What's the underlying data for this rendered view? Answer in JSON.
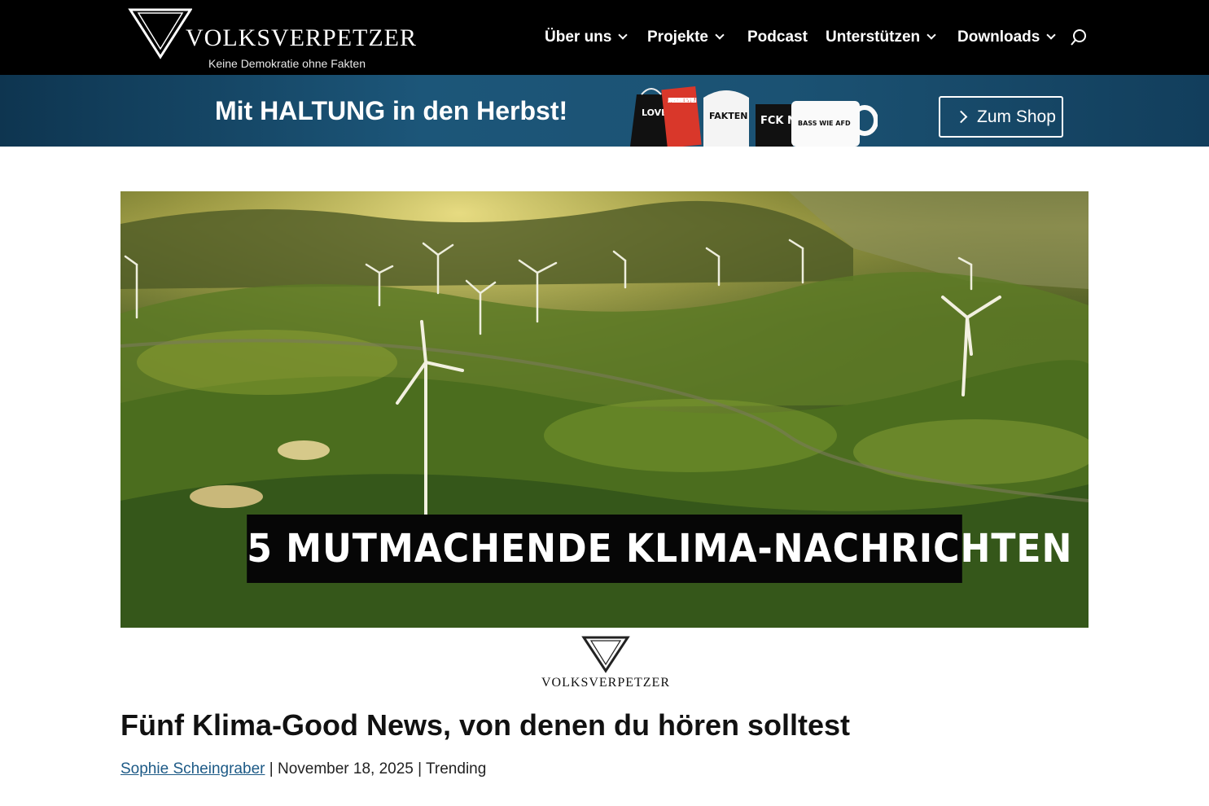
{
  "header": {
    "logo": {
      "wordmark": "VOLKSVERPETZER",
      "tagline": "Keine Demokratie ohne Fakten"
    },
    "nav": [
      {
        "label": "Über uns",
        "has_dropdown": true
      },
      {
        "label": "Projekte",
        "has_dropdown": true
      },
      {
        "label": "Podcast",
        "has_dropdown": false
      },
      {
        "label": "Unterstützen",
        "has_dropdown": true
      },
      {
        "label": "Downloads",
        "has_dropdown": true
      }
    ],
    "search_icon": "search-icon"
  },
  "promo": {
    "title": "Mit HALTUNG in den Herbst!",
    "button_label": "Zum Shop",
    "merch_texts": [
      "LOVE WINS",
      "FAKTEN GEGEN RECHTE MYTHEN",
      "FAKTEN",
      "FCK NZS",
      "BASS WIE AFD"
    ]
  },
  "hero": {
    "caption": "5 MUTMACHENDE KLIMA-NACHRICHTEN",
    "logo_word": "VOLKSVERPETZER"
  },
  "article": {
    "title": "Fünf Klima-Good News, von denen du hören solltest",
    "author": "Sophie Scheingraber",
    "date": "November 18, 2025",
    "category": "Trending"
  },
  "colors": {
    "header_bg": "#000000",
    "promo_bg": "#1c5679",
    "link": "#1d5a86"
  }
}
